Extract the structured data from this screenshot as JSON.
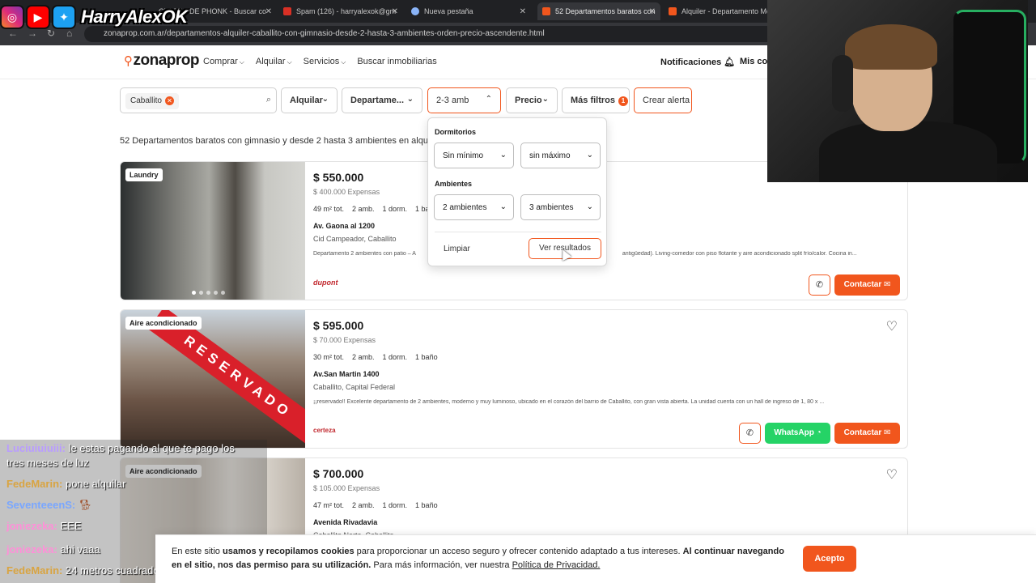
{
  "browser": {
    "tabs": [
      {
        "label": "CLASES DE PHONK - Buscar co"
      },
      {
        "label": "Spam (126) - harryalexok@gm"
      },
      {
        "label": "Nueva pestaña"
      },
      {
        "label": "52 Departamentos baratos con"
      },
      {
        "label": "Alquiler - Departamento Mon"
      }
    ],
    "url": "zonaprop.com.ar/departamentos-alquiler-caballito-con-gimnasio-desde-2-hasta-3-ambientes-orden-precio-ascendente.html"
  },
  "overlay": {
    "handle": "HarryAlexOK"
  },
  "site": {
    "logo": "zonaprop",
    "nav": [
      "Comprar",
      "Alquilar",
      "Servicios",
      "Buscar inmobiliarias"
    ],
    "notifications": "Notificaciones",
    "account": "Mis co"
  },
  "filters": {
    "location_chip": "Caballito",
    "operation": "Alquilar",
    "property_type": "Departame...",
    "rooms": "2-3 amb",
    "price": "Precio",
    "more_filters": "Más filtros",
    "more_filters_count": "1",
    "create_alert": "Crear alerta"
  },
  "results_title": "52 Departamentos baratos con gimnasio y desde 2 hasta 3 ambientes en alquiler e",
  "dropdown": {
    "bedrooms_label": "Dormitorios",
    "bedrooms_min": "Sin mínimo",
    "bedrooms_max": "sin máximo",
    "rooms_label": "Ambientes",
    "rooms_min": "2 ambientes",
    "rooms_max": "3 ambientes",
    "clear": "Limpiar",
    "see_results": "Ver resultados"
  },
  "listings": [
    {
      "tag": "Laundry",
      "price": "$ 550.000",
      "expenses": "$ 400.000 Expensas",
      "area": "49 m² tot.",
      "rooms": "2 amb.",
      "bedrooms": "1 dorm.",
      "baths": "1 ba",
      "address": "Av. Gaona al 1200",
      "location": "Cid Campeador, Caballito",
      "description": "Departamento 2 ambientes con patio – A",
      "description_tail": "antigüedad). Living-comedor con piso flotante y aire acondicionado split frío/calor. Cocina in...",
      "agency": "dupont",
      "contact": "Contactar"
    },
    {
      "tag": "Aire acondicionado",
      "reserved": "RESERVADO",
      "price": "$ 595.000",
      "expenses": "$ 70.000 Expensas",
      "area": "30 m² tot.",
      "rooms": "2 amb.",
      "bedrooms": "1 dorm.",
      "baths": "1 baño",
      "address": "Av.San Martin 1400",
      "location": "Caballito, Capital Federal",
      "description": "¡¡reservado!! Excelente departamento de 2 ambientes, moderno y muy luminoso, ubicado en el corazón del barrio de Caballito, con gran vista abierta. La unidad cuenta con un hall de ingreso de 1, 80 x ...",
      "agency": "certeza",
      "whatsapp": "WhatsApp",
      "contact": "Contactar"
    },
    {
      "tag": "Aire acondicionado",
      "price": "$ 700.000",
      "expenses": "$ 105.000 Expensas",
      "area": "47 m² tot.",
      "rooms": "2 amb.",
      "bedrooms": "1 dorm.",
      "baths": "1 baño",
      "address": "Avenida Rivadavia",
      "location": "Caballito Norte, Caballito"
    }
  ],
  "chat": [
    {
      "user": "Luciuiuiuiii:",
      "text": "le estas pagando al que te pago los",
      "color": "#b99cff"
    },
    {
      "user": "",
      "text": "tres meses de luz",
      "color": "#b99cff"
    },
    {
      "user": "FedeMarin:",
      "text": "pone alquilar",
      "color": "#d9a441"
    },
    {
      "user": "SeventeeenS:",
      "text": "",
      "color": "#7aa7ff"
    },
    {
      "user": "joniezeka:",
      "text": "EEE",
      "color": "#ff8fd8"
    },
    {
      "user": "joniezeka:",
      "text": "ahi vaaa",
      "color": "#ff8fd8"
    },
    {
      "user": "FedeMarin:",
      "text": "24 metros cuadrados",
      "color": "#d9a441"
    }
  ],
  "cookie": {
    "p1": "En este sitio ",
    "b1": "usamos y recopilamos cookies",
    "p2": " para proporcionar un acceso seguro y ofrecer contenido adaptado a tus intereses. ",
    "b2": "Al continuar navegando en el sitio, nos das permiso para su utilización.",
    "p3": " Para más información, ver nuestra ",
    "link": "Política de Privacidad.",
    "accept": "Acepto"
  },
  "colors": {
    "brand": "#f1561d",
    "whatsapp": "#25d366",
    "reserved": "#d9202a"
  }
}
